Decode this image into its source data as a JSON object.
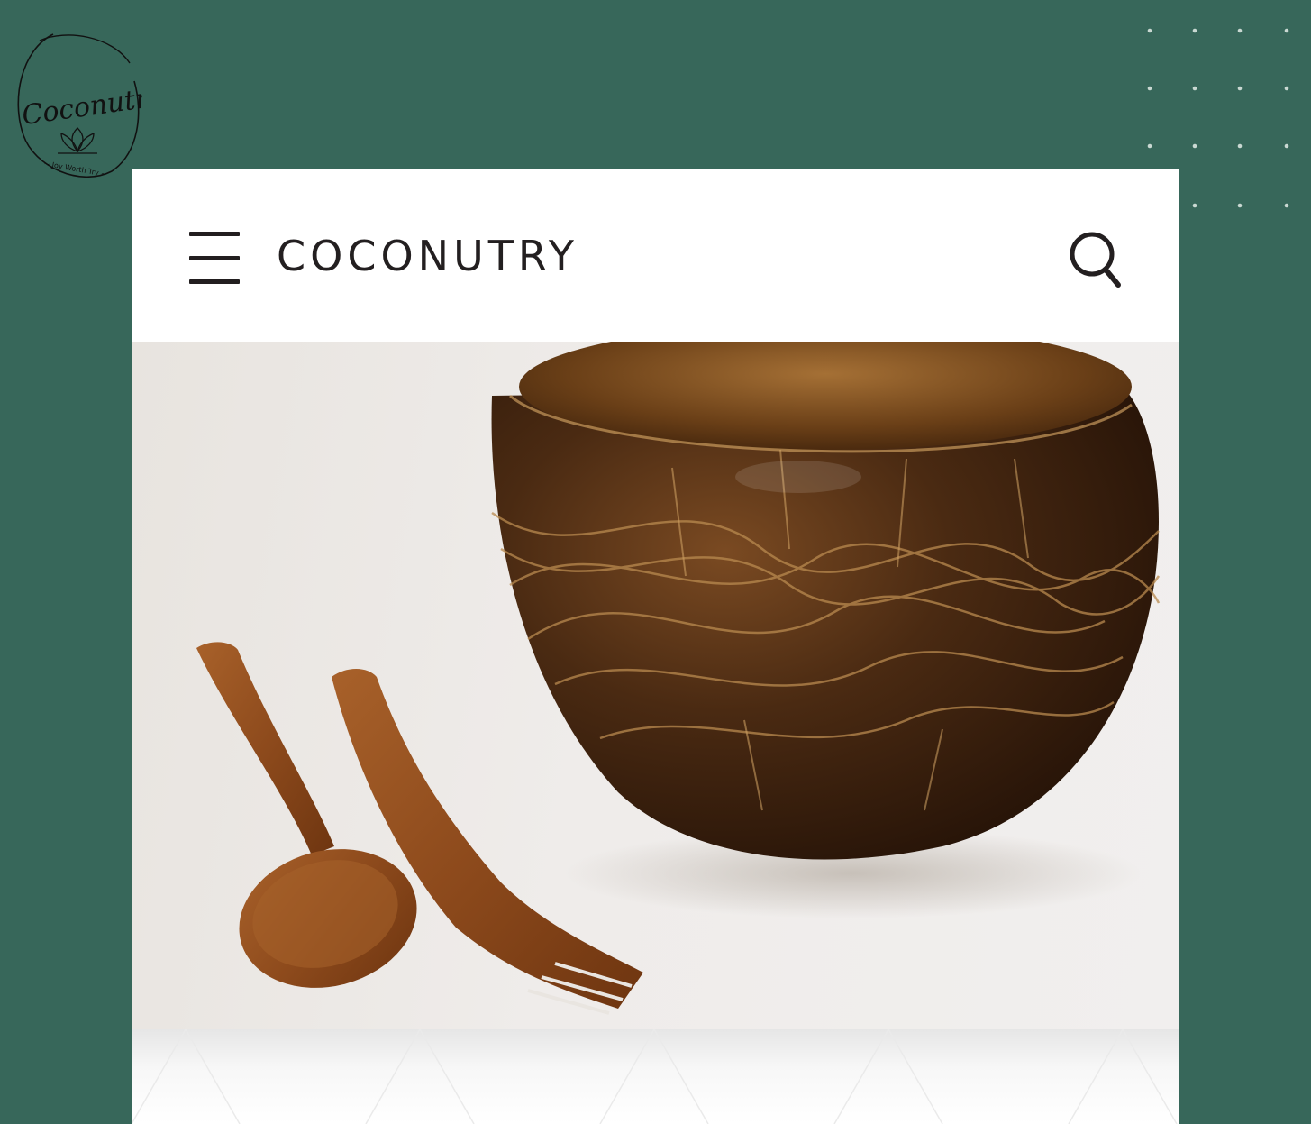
{
  "logo": {
    "script_text": "Coconutry",
    "tagline": "~ Joy Worth Try ~"
  },
  "header": {
    "brand": "COCONUTRY"
  },
  "icons": {
    "menu": "hamburger-menu-icon",
    "search": "search-icon"
  },
  "colors": {
    "background": "#37675a",
    "card": "#ffffff",
    "text": "#231f20"
  }
}
